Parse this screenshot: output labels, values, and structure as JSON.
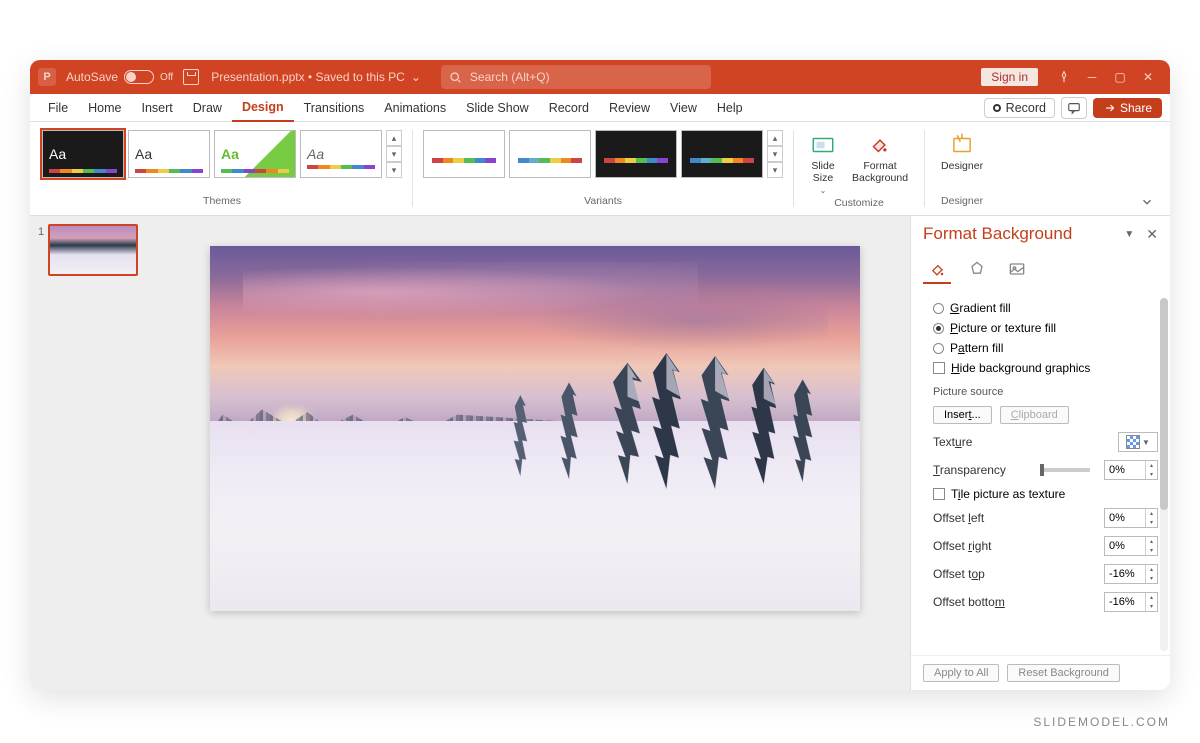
{
  "titlebar": {
    "app_icon": "P",
    "autosave_label": "AutoSave",
    "autosave_state": "Off",
    "doc_title": "Presentation.pptx • Saved to this PC",
    "search_placeholder": "Search (Alt+Q)",
    "signin": "Sign in"
  },
  "menu": {
    "items": [
      "File",
      "Home",
      "Insert",
      "Draw",
      "Design",
      "Transitions",
      "Animations",
      "Slide Show",
      "Record",
      "Review",
      "View",
      "Help"
    ],
    "active": "Design",
    "record": "Record",
    "share": "Share"
  },
  "ribbon": {
    "themes_label": "Themes",
    "variants_label": "Variants",
    "customize_label": "Customize",
    "designer_label": "Designer",
    "slide_size": "Slide\nSize",
    "format_bg": "Format\nBackground",
    "designer_btn": "Designer"
  },
  "thumb": {
    "num": "1"
  },
  "pane": {
    "title": "Format Background",
    "options": {
      "gradient": "Gradient fill",
      "picture": "Picture or texture fill",
      "pattern": "Pattern fill",
      "hide": "Hide background graphics"
    },
    "picture_source": "Picture source",
    "insert": "Insert...",
    "clipboard": "Clipboard",
    "texture": "Texture",
    "transparency": "Transparency",
    "transparency_val": "0%",
    "tile": "Tile picture as texture",
    "offset_left": "Offset left",
    "offset_left_val": "0%",
    "offset_right": "Offset right",
    "offset_right_val": "0%",
    "offset_top": "Offset top",
    "offset_top_val": "-16%",
    "offset_bottom": "Offset bottom",
    "offset_bottom_val": "-16%",
    "apply_all": "Apply to All",
    "reset": "Reset Background"
  },
  "watermark": "SLIDEMODEL.COM"
}
